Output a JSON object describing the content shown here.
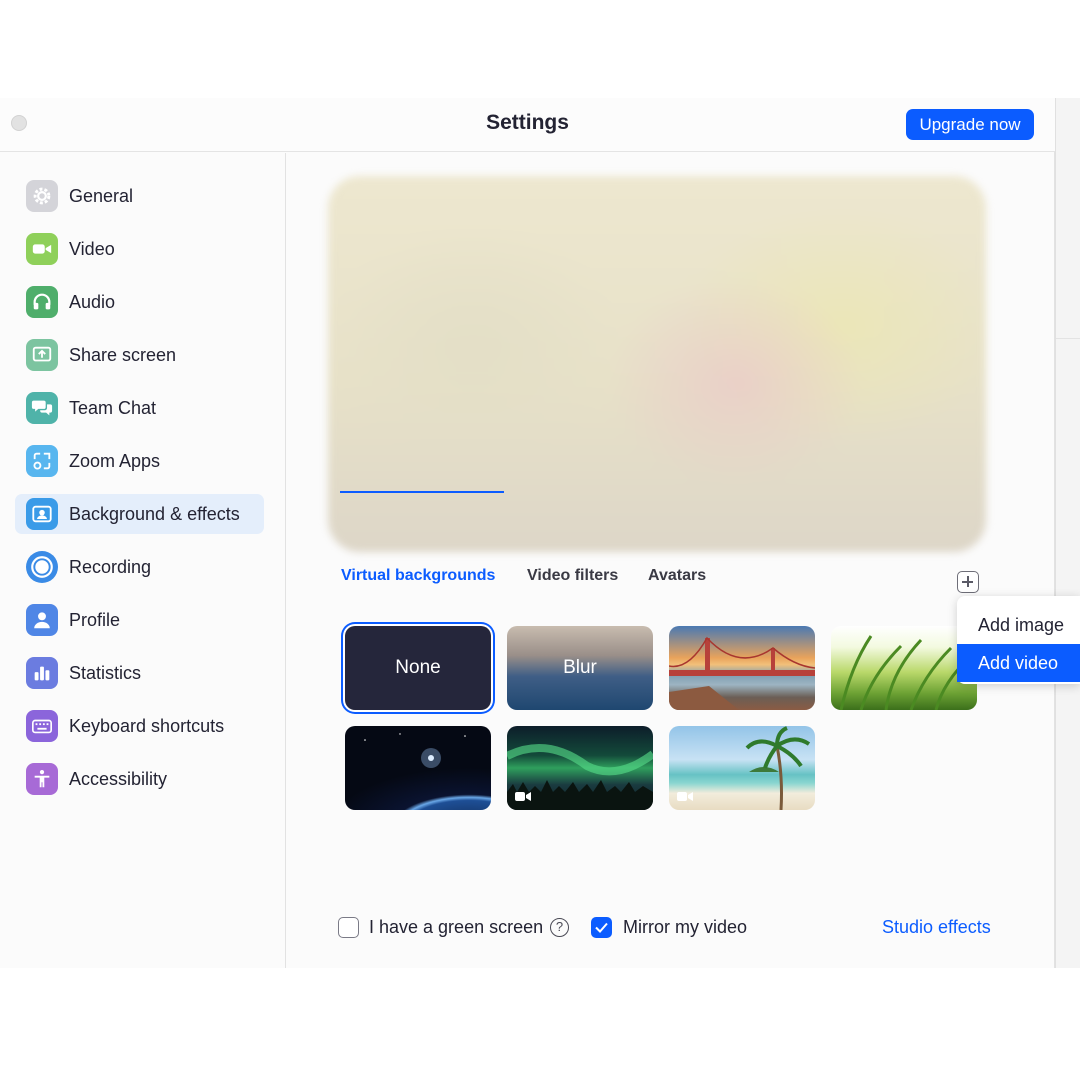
{
  "window": {
    "title": "Settings",
    "upgrade_label": "Upgrade now"
  },
  "sidebar": {
    "items": [
      {
        "label": "General",
        "icon": "gear-icon",
        "color": "#c9c9cf"
      },
      {
        "label": "Video",
        "icon": "video-camera-icon",
        "color": "#8fd05a"
      },
      {
        "label": "Audio",
        "icon": "headphones-icon",
        "color": "#4fae6b"
      },
      {
        "label": "Share screen",
        "icon": "share-screen-icon",
        "color": "#7cc4a0"
      },
      {
        "label": "Team Chat",
        "icon": "chat-bubbles-icon",
        "color": "#4fb3a9"
      },
      {
        "label": "Zoom Apps",
        "icon": "apps-icon",
        "color": "#58b6ef"
      },
      {
        "label": "Background & effects",
        "icon": "portrait-icon",
        "color": "#3a9be8"
      },
      {
        "label": "Recording",
        "icon": "record-icon",
        "color": "#3a8be6"
      },
      {
        "label": "Profile",
        "icon": "person-icon",
        "color": "#4f86e6"
      },
      {
        "label": "Statistics",
        "icon": "bar-chart-icon",
        "color": "#6b7ce0"
      },
      {
        "label": "Keyboard shortcuts",
        "icon": "keyboard-icon",
        "color": "#8b65db"
      },
      {
        "label": "Accessibility",
        "icon": "accessibility-icon",
        "color": "#a76ad6"
      }
    ],
    "active": "Background & effects"
  },
  "tabs": [
    {
      "label": "Virtual backgrounds",
      "active": true
    },
    {
      "label": "Video filters",
      "active": false
    },
    {
      "label": "Avatars",
      "active": false
    }
  ],
  "backgrounds": {
    "none_label": "None",
    "blur_label": "Blur",
    "items": [
      "None",
      "Blur",
      "Golden Gate Bridge",
      "Grass",
      "Earth",
      "Aurora",
      "Beach"
    ],
    "selected": "None"
  },
  "add_menu": {
    "items": [
      "Add image",
      "Add video"
    ],
    "highlighted": "Add video"
  },
  "footer": {
    "green_screen_label": "I have a green screen",
    "green_screen_checked": false,
    "mirror_label": "Mirror my video",
    "mirror_checked": true,
    "studio_effects_label": "Studio effects"
  },
  "colors": {
    "accent": "#0b5cff",
    "active_nav_bg": "#e4eefb",
    "none_tile": "#25263b"
  }
}
